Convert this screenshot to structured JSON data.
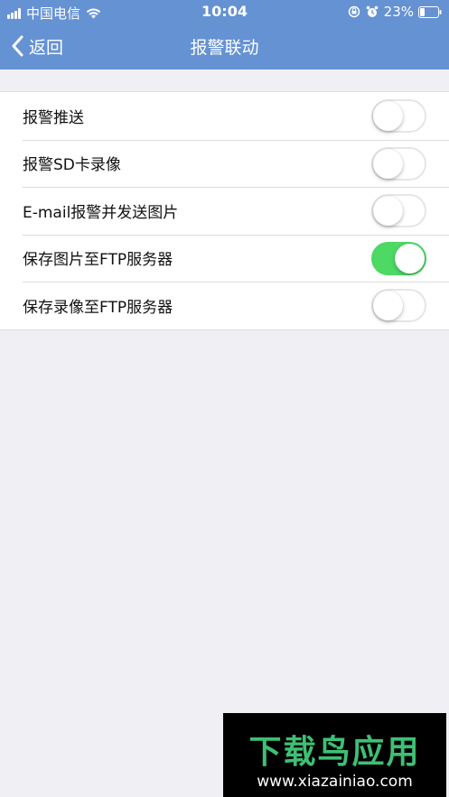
{
  "status_bar": {
    "carrier": "中国电信",
    "time": "10:04",
    "battery": "23%"
  },
  "nav": {
    "back_label": "返回",
    "title": "报警联动"
  },
  "settings": [
    {
      "label": "报警推送",
      "on": false
    },
    {
      "label": "报警SD卡录像",
      "on": false
    },
    {
      "label": "E-mail报警并发送图片",
      "on": false
    },
    {
      "label": "保存图片至FTP服务器",
      "on": true
    },
    {
      "label": "保存录像至FTP服务器",
      "on": false
    }
  ],
  "watermark": {
    "logo_text": "下载鸟应用",
    "url": "www.xiazainiao.com"
  },
  "colors": {
    "header": "#6592d3",
    "toggle_on": "#4cd964",
    "background": "#efeff4"
  }
}
